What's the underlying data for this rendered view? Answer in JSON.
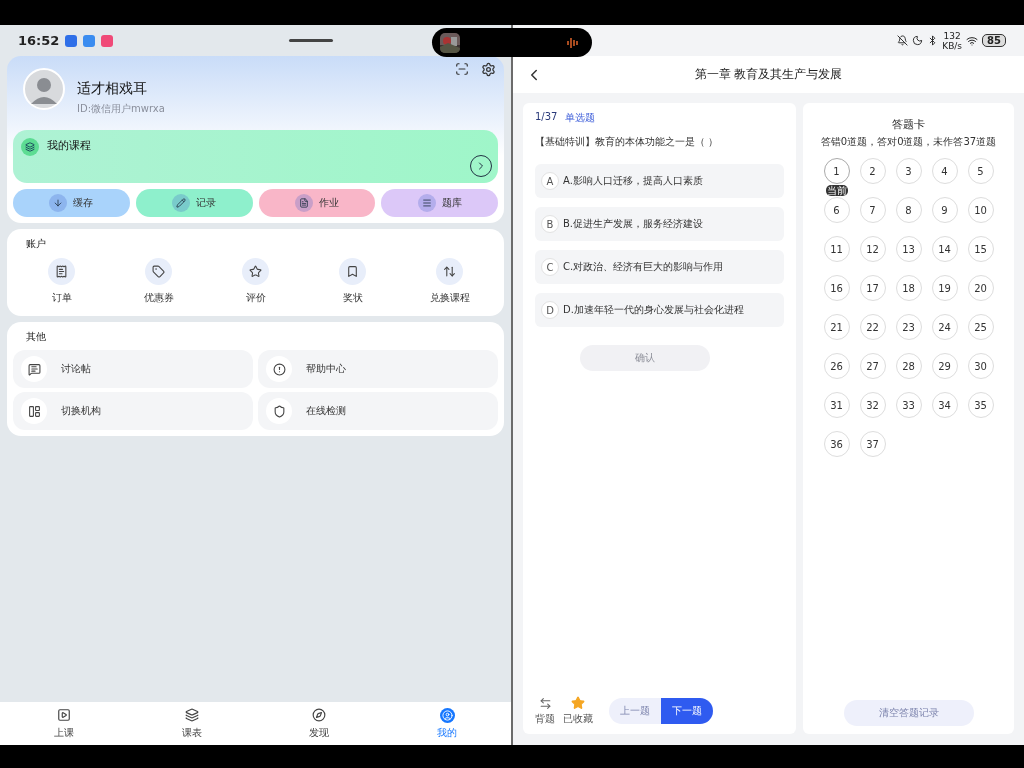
{
  "status": {
    "time": "16:52",
    "net_speed": "132",
    "net_unit": "KB/s",
    "battery": "85"
  },
  "profile": {
    "name": "适才相戏耳",
    "id": "ID:微信用户mwrxa"
  },
  "course_card": {
    "title": "我的课程"
  },
  "quick_actions": [
    {
      "label": "缓存",
      "color": "#a9d3fb"
    },
    {
      "label": "记录",
      "color": "#8ef0cc"
    },
    {
      "label": "作业",
      "color": "#f9b6c8"
    },
    {
      "label": "题库",
      "color": "#dcc8f8"
    }
  ],
  "account": {
    "title": "账户",
    "items": [
      "订单",
      "优惠券",
      "评价",
      "奖状",
      "兑换课程"
    ]
  },
  "others": {
    "title": "其他",
    "items": [
      "讨论帖",
      "帮助中心",
      "切换机构",
      "在线检测"
    ]
  },
  "tab_bar": [
    {
      "label": "上课",
      "selected": false
    },
    {
      "label": "课表",
      "selected": false
    },
    {
      "label": "发现",
      "selected": false
    },
    {
      "label": "我的",
      "selected": true
    }
  ],
  "quiz": {
    "title": "第一章 教育及其生产与发展",
    "progress": "1/37",
    "type": "单选题",
    "question": "【基础特训】教育的本体功能之一是（ ）",
    "options": [
      {
        "letter": "A",
        "text": "A.影响人口迁移，提高人口素质"
      },
      {
        "letter": "B",
        "text": "B.促进生产发展，服务经济建设"
      },
      {
        "letter": "C",
        "text": "C.对政治、经济有巨大的影响与作用"
      },
      {
        "letter": "D",
        "text": "D.加速年轻一代的身心发展与社会化进程"
      }
    ],
    "confirm": {
      "label": "确认",
      "disabled": true
    },
    "tools": [
      {
        "kind": "recite",
        "label": "背题"
      },
      {
        "kind": "favorite",
        "label": "已收藏"
      }
    ],
    "prev": {
      "label": "上一题",
      "disabled": true
    },
    "next": {
      "label": "下一题",
      "disabled": false
    }
  },
  "answer_card": {
    "title": "答题卡",
    "summary": "答错0道题，答对0道题，未作答37道题",
    "current_label": "当前",
    "numbers": [
      {
        "n": "1",
        "selected": true
      },
      {
        "n": "2",
        "selected": false
      },
      {
        "n": "3",
        "selected": false
      },
      {
        "n": "4",
        "selected": false
      },
      {
        "n": "5",
        "selected": false
      },
      {
        "n": "6",
        "selected": false
      },
      {
        "n": "7",
        "selected": false
      },
      {
        "n": "8",
        "selected": false
      },
      {
        "n": "9",
        "selected": false
      },
      {
        "n": "10",
        "selected": false
      },
      {
        "n": "11",
        "selected": false
      },
      {
        "n": "12",
        "selected": false
      },
      {
        "n": "13",
        "selected": false
      },
      {
        "n": "14",
        "selected": false
      },
      {
        "n": "15",
        "selected": false
      },
      {
        "n": "16",
        "selected": false
      },
      {
        "n": "17",
        "selected": false
      },
      {
        "n": "18",
        "selected": false
      },
      {
        "n": "19",
        "selected": false
      },
      {
        "n": "20",
        "selected": false
      },
      {
        "n": "21",
        "selected": false
      },
      {
        "n": "22",
        "selected": false
      },
      {
        "n": "23",
        "selected": false
      },
      {
        "n": "24",
        "selected": false
      },
      {
        "n": "25",
        "selected": false
      },
      {
        "n": "26",
        "selected": false
      },
      {
        "n": "27",
        "selected": false
      },
      {
        "n": "28",
        "selected": false
      },
      {
        "n": "29",
        "selected": false
      },
      {
        "n": "30",
        "selected": false
      },
      {
        "n": "31",
        "selected": false
      },
      {
        "n": "32",
        "selected": false
      },
      {
        "n": "33",
        "selected": false
      },
      {
        "n": "34",
        "selected": false
      },
      {
        "n": "35",
        "selected": false
      },
      {
        "n": "36",
        "selected": false
      },
      {
        "n": "37",
        "selected": false
      }
    ],
    "clear": {
      "label": "清空答题记录",
      "disabled": true
    }
  }
}
